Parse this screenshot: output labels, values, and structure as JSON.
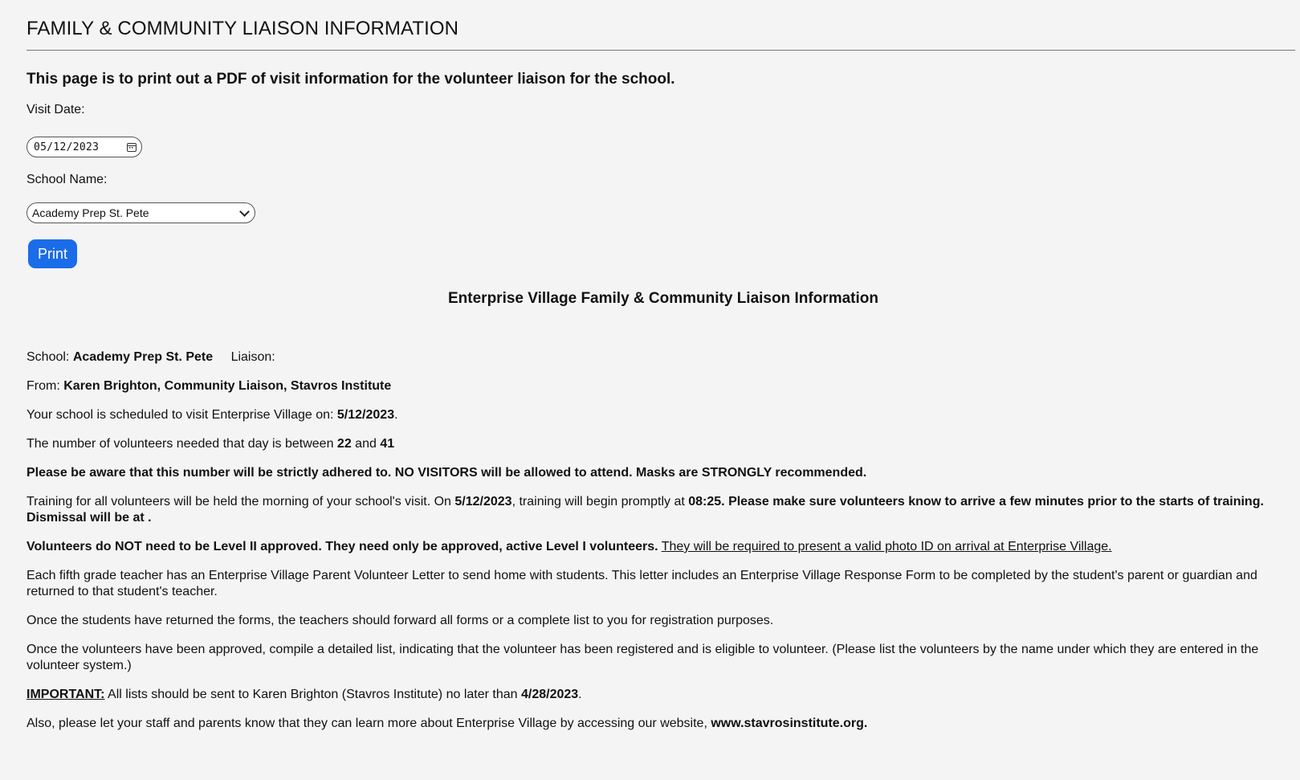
{
  "header": {
    "title": "FAMILY & COMMUNITY LIAISON INFORMATION",
    "intro": "This page is to print out a PDF of visit information for the volunteer liaison for the school."
  },
  "form": {
    "visit_date_label": "Visit Date:",
    "visit_date_value": "05/12/2023",
    "school_name_label": "School Name:",
    "school_name_value": "Academy Prep St. Pete",
    "print_label": "Print"
  },
  "letter": {
    "heading": "Enterprise Village Family & Community Liaison Information",
    "school_label": "School:",
    "school_value": "Academy Prep St. Pete",
    "liaison_label": "Liaison:",
    "from_label": "From:",
    "from_value": "Karen Brighton, Community Liaison, Stavros Institute",
    "scheduled_text": "Your school is scheduled to visit Enterprise Village on:",
    "visit_date": "5/12/2023",
    "volunteers_text": "The number of volunteers needed that day is between",
    "volunteers_min": "22",
    "and_text": "and",
    "volunteers_max": "41",
    "adherence_notice": "Please be aware that this number will be strictly adhered to. NO VISITORS will be allowed to attend. Masks are STRONGLY recommended.",
    "training_text_1": "Training for all volunteers will be held the morning of your school's visit. On",
    "training_date": "5/12/2023",
    "training_text_2": ", training will begin promptly at",
    "training_time": "08:25",
    "training_text_3": ". Please make sure volunteers know to arrive a few minutes prior to the starts of training. Dismissal will be at .",
    "level_text": "Volunteers do NOT need to be Level II approved. They need only be approved, active Level I volunteers.",
    "photo_id_text": "They will be required to present a valid photo ID on arrival at Enterprise Village.",
    "teacher_letter_text": "Each fifth grade teacher has an Enterprise Village Parent Volunteer Letter to send home with students. This letter includes an Enterprise Village Response Form to be completed by the student's parent or guardian and returned to that student's teacher.",
    "forms_text": "Once the students have returned the forms, the teachers should forward all forms or a complete list to you for registration purposes.",
    "approved_text": "Once the volunteers have been approved, compile a detailed list, indicating that the volunteer has been registered and is eligible to volunteer. (Please list the volunteers by the name under which they are entered in the volunteer system.)",
    "important_label": "IMPORTANT:",
    "important_text": "All lists should be sent to Karen Brighton (Stavros Institute) no later than",
    "deadline": "4/28/2023",
    "website_text": "Also, please let your staff and parents know that they can learn more about Enterprise Village by accessing our website,",
    "website": "www.stavrosinstitute.org."
  }
}
